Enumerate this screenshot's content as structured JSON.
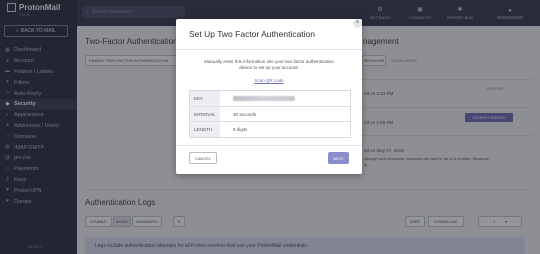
{
  "app": {
    "logo": "ProtonMail",
    "logo_sub": "PLUS",
    "version": "v3.15.47"
  },
  "sidebar": {
    "back_label": "BACK TO MAIL",
    "items": [
      {
        "label": "Dashboard",
        "icon": "dashboard-icon"
      },
      {
        "label": "Account",
        "icon": "user-icon"
      },
      {
        "label": "Folders / Labels",
        "icon": "folder-icon"
      },
      {
        "label": "Filters",
        "icon": "filter-icon"
      },
      {
        "label": "Auto-Reply",
        "icon": "reply-icon"
      },
      {
        "label": "Security",
        "icon": "shield-icon"
      },
      {
        "label": "Appearance",
        "icon": "palette-icon"
      },
      {
        "label": "Addresses / Users",
        "icon": "users-icon"
      },
      {
        "label": "Domains",
        "icon": "globe-icon"
      },
      {
        "label": "IMAP/SMTP",
        "icon": "server-icon"
      },
      {
        "label": "pm.me",
        "icon": "at-icon"
      },
      {
        "label": "Payments",
        "icon": "card-icon"
      },
      {
        "label": "Keys",
        "icon": "key-icon"
      },
      {
        "label": "ProtonVPN",
        "icon": "vpn-icon"
      },
      {
        "label": "Donate",
        "icon": "heart-icon"
      }
    ]
  },
  "topbar": {
    "search_placeholder": "Search messages",
    "items": [
      {
        "label": "SETTINGS",
        "icon": "gear-icon"
      },
      {
        "label": "CONTACTS",
        "icon": "contacts-icon"
      },
      {
        "label": "REPORT BUG",
        "icon": "bug-icon"
      }
    ]
  },
  "main": {
    "tfa_title": "Two-Factor Authentication",
    "enable_label": "ENABLE TWO-FACTOR AUTHENTICATION",
    "sessions_title": "nagement",
    "sessions_btn": "SESSIONS",
    "learn_more": "LEARN MORE",
    "sessions": [
      {
        "text": "ed on 2:33 PM",
        "action": "REVOKE"
      },
      {
        "text": "ed on 1:56 PM",
        "action": "CURRENT SESSION"
      },
      {
        "text": "ed on May 27, 2019",
        "action": ""
      }
    ],
    "password_note": "change your password, sessions can last for up to 6 months. Sessions",
    "password_note2": "ly.",
    "logs_title": "Authentication Logs",
    "log_tabs": [
      "DISABLE",
      "BASIC",
      "ADVANCED"
    ],
    "wipe": "WIPE",
    "download": "DOWNLOAD",
    "page": "1",
    "info": "Logs include authentication attempts for all Proton services that use your ProtonMail credentials."
  },
  "modal": {
    "title": "Set Up Two Factor Authentication",
    "close": "×",
    "desc": "Manually enter this information into your two factor authentication device to set up your account.",
    "scan_link": "Scan QR code",
    "rows": [
      {
        "key": "KEY",
        "value": ""
      },
      {
        "key": "INTERVAL",
        "value": "30 seconds"
      },
      {
        "key": "LENGTH",
        "value": "6 digits"
      }
    ],
    "cancel": "CANCEL",
    "next": "NEXT"
  }
}
